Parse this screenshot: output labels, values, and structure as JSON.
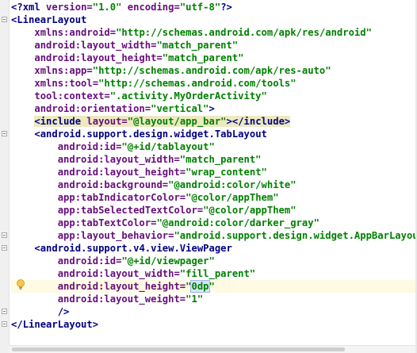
{
  "editor": {
    "lines": [
      [
        [
          "lt",
          "<?"
        ],
        [
          "tn",
          "xml "
        ],
        [
          "an",
          "version="
        ],
        [
          "av",
          "\"1.0\" "
        ],
        [
          "an",
          "encoding="
        ],
        [
          "av",
          "\"utf-8\""
        ],
        [
          "lt",
          "?>"
        ]
      ],
      [
        [
          "lt",
          "<"
        ],
        [
          "tn",
          "LinearLayout"
        ]
      ],
      [
        [
          "tx",
          "    "
        ],
        [
          "an",
          "xmlns:android="
        ],
        [
          "av",
          "\"http://schemas.android.com/apk/res/android\""
        ]
      ],
      [
        [
          "tx",
          "    "
        ],
        [
          "an",
          "android:layout_width="
        ],
        [
          "av",
          "\"match_parent\""
        ]
      ],
      [
        [
          "tx",
          "    "
        ],
        [
          "an",
          "android:layout_height="
        ],
        [
          "av",
          "\"match_parent\""
        ]
      ],
      [
        [
          "tx",
          "    "
        ],
        [
          "an",
          "xmlns:app="
        ],
        [
          "av",
          "\"http://schemas.android.com/apk/res-auto\""
        ]
      ],
      [
        [
          "tx",
          "    "
        ],
        [
          "an",
          "xmlns:tool="
        ],
        [
          "av",
          "\"http://schemas.android.com/tools\""
        ]
      ],
      [
        [
          "tx",
          "    "
        ],
        [
          "an",
          "tool:context="
        ],
        [
          "av",
          "\".activity.MyOrderActivity\""
        ]
      ],
      [
        [
          "tx",
          "    "
        ],
        [
          "an",
          "android:orientation="
        ],
        [
          "av",
          "\"vertical\""
        ],
        [
          "lt",
          ">"
        ]
      ],
      [
        [
          "tx",
          "    "
        ],
        [
          "hlt",
          "<"
        ],
        [
          "htn",
          "include "
        ],
        [
          "han",
          "layout="
        ],
        [
          "hav",
          "\"@layout/app_bar\""
        ],
        [
          "hlt",
          "></"
        ],
        [
          "htn",
          "include"
        ],
        [
          "hlt",
          ">"
        ]
      ],
      [
        [
          "tx",
          "    "
        ],
        [
          "lt",
          "<"
        ],
        [
          "tn",
          "android.support.design.widget.TabLayout"
        ]
      ],
      [
        [
          "tx",
          "        "
        ],
        [
          "an",
          "android:id="
        ],
        [
          "av",
          "\"@+id/tablayout\""
        ]
      ],
      [
        [
          "tx",
          "        "
        ],
        [
          "an",
          "android:layout_width="
        ],
        [
          "av",
          "\"match_parent\""
        ]
      ],
      [
        [
          "tx",
          "        "
        ],
        [
          "an",
          "android:layout_height="
        ],
        [
          "av",
          "\"wrap_content\""
        ]
      ],
      [
        [
          "tx",
          "        "
        ],
        [
          "an",
          "android:background="
        ],
        [
          "av",
          "\"@android:color/white\""
        ]
      ],
      [
        [
          "tx",
          "        "
        ],
        [
          "an",
          "app:tabIndicatorColor="
        ],
        [
          "av",
          "\"@color/appThem\""
        ]
      ],
      [
        [
          "tx",
          "        "
        ],
        [
          "an",
          "app:tabSelectedTextColor="
        ],
        [
          "av",
          "\"@color/appThem\""
        ]
      ],
      [
        [
          "tx",
          "        "
        ],
        [
          "an",
          "app:tabTextColor="
        ],
        [
          "av",
          "\"@android:color/darker_gray\""
        ]
      ],
      [
        [
          "tx",
          "        "
        ],
        [
          "an",
          "app:layout_behavior="
        ],
        [
          "av",
          "\"android.support.design.widget.AppBarLayout$S"
        ]
      ],
      [
        [
          "tx",
          "    "
        ],
        [
          "lt",
          "<"
        ],
        [
          "tn",
          "android.support.v4.view.ViewPager"
        ]
      ],
      [
        [
          "tx",
          "        "
        ],
        [
          "an",
          "android:id="
        ],
        [
          "av",
          "\"@+id/viewpager\""
        ]
      ],
      [
        [
          "tx",
          "        "
        ],
        [
          "an",
          "android:layout_width="
        ],
        [
          "av",
          "\"fill_parent\""
        ]
      ],
      [
        [
          "tx",
          "        "
        ],
        [
          "an",
          "android:layout_height="
        ],
        [
          "av",
          "\""
        ],
        [
          "sel",
          "0dp"
        ],
        [
          "av",
          "\""
        ]
      ],
      [
        [
          "tx",
          "        "
        ],
        [
          "an",
          "android:layout_weight="
        ],
        [
          "av",
          "\"1\""
        ]
      ],
      [
        [
          "tx",
          "        "
        ],
        [
          "lt",
          "/>"
        ]
      ],
      [
        [
          "lt",
          "</"
        ],
        [
          "tn",
          "LinearLayout"
        ],
        [
          "lt",
          ">"
        ]
      ]
    ],
    "current_line": 22,
    "fold_markers": [
      {
        "line": 1,
        "kind": "open"
      },
      {
        "line": 10,
        "kind": "open"
      },
      {
        "line": 18,
        "kind": "close"
      },
      {
        "line": 19,
        "kind": "open"
      },
      {
        "line": 24,
        "kind": "close"
      },
      {
        "line": 25,
        "kind": "close"
      }
    ],
    "colors": {
      "tag": "#000080",
      "attribute": "#660e7a",
      "value": "#008000",
      "current_line": "#fffae3",
      "include_highlight": "#ede9c1"
    },
    "icons": [
      "intention-bulb-icon",
      "fold-marker-icon"
    ]
  }
}
